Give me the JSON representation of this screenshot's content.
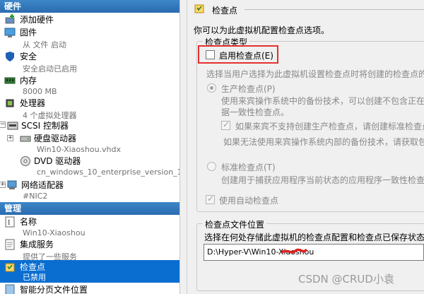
{
  "sections": {
    "hardware": "硬件",
    "management": "管理"
  },
  "hardware_items": [
    {
      "title": "添加硬件",
      "sub": ""
    },
    {
      "title": "固件",
      "sub": "从 文件 启动"
    },
    {
      "title": "安全",
      "sub": "安全启动已启用"
    },
    {
      "title": "内存",
      "sub": "8000 MB"
    },
    {
      "title": "处理器",
      "sub": "4 个虚拟处理器"
    },
    {
      "title": "SCSI 控制器",
      "sub": ""
    },
    {
      "title": "硬盘驱动器",
      "sub": "Win10-Xiaoshou.vhdx"
    },
    {
      "title": "DVD 驱动器",
      "sub": "cn_windows_10_enterprise_version_1..."
    },
    {
      "title": "网络适配器",
      "sub": "#NIC2"
    }
  ],
  "management_items": [
    {
      "title": "名称",
      "sub": "Win10-Xiaoshou"
    },
    {
      "title": "集成服务",
      "sub": "提供了一些服务"
    },
    {
      "title": "检查点",
      "sub": "已禁用"
    },
    {
      "title": "智能分页文件位置",
      "sub": ""
    }
  ],
  "panel": {
    "header": "检查点",
    "description": "你可以为此虚拟机配置检查点选项。",
    "type_group_title": "检查点类型",
    "enable_label": "启用检查点(E)",
    "choose_text": "选择当用户选择为此虚拟机设置检查点时将创建的检查点的",
    "production_label": "生产检查点(P)",
    "production_desc_1": "使用来宾操作系统中的备份技术，可以创建不包含正在",
    "production_desc_2": "据一致性检查点。",
    "fallback_label": "如果来宾不支持创建生产检查点，请创建标准检查点",
    "fallback_desc": "如果无法使用来宾操作系统内部的备份技术，请获取包",
    "standard_label": "标准检查点(T)",
    "standard_desc": "创建用于捕获应用程序当前状态的应用程序一致性检查",
    "auto_label": "使用自动检查点",
    "location_group_title": "检查点文件位置",
    "location_desc": "选择在何处存储此虚拟机的检查点配置和检查点已保存状态",
    "path_value": "D:\\Hyper-V\\Win10-Xiaoshou"
  },
  "watermark": "CSDN @CRUD小袁",
  "colors": {
    "selection": "#0a6ed1",
    "header": "#2a6bb0",
    "highlight": "#e53030"
  }
}
